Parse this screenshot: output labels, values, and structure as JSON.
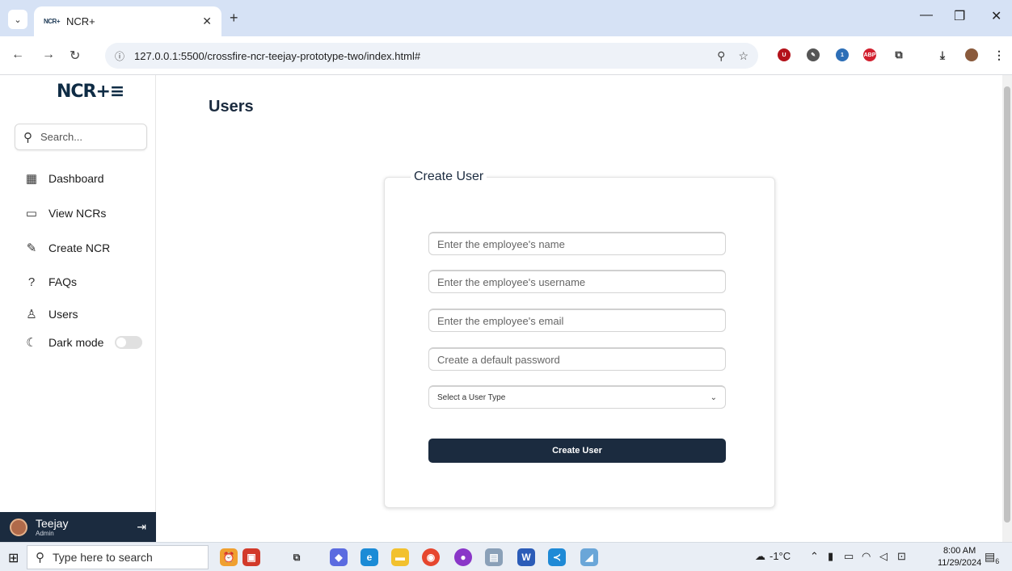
{
  "browser": {
    "tab_title": "NCR+",
    "tab_favicon": "NCR+",
    "url": "127.0.0.1:5500/crossfire-ncr-teejay-prototype-two/index.html#"
  },
  "sidebar": {
    "logo": "NCR+≡",
    "search_placeholder": "Search...",
    "items": [
      {
        "label": "Dashboard",
        "icon": "dashboard-icon"
      },
      {
        "label": "View NCRs",
        "icon": "folder-icon"
      },
      {
        "label": "Create NCR",
        "icon": "edit-icon"
      },
      {
        "label": "FAQs",
        "icon": "question-icon"
      },
      {
        "label": "Users",
        "icon": "user-icon"
      },
      {
        "label": "Dark mode",
        "icon": "moon-icon"
      }
    ],
    "dark_mode_on": false,
    "user": {
      "name": "Teejay",
      "role": "Admin"
    }
  },
  "main": {
    "title": "Users",
    "form": {
      "legend": "Create User",
      "name_placeholder": "Enter the employee's name",
      "username_placeholder": "Enter the employee's username",
      "email_placeholder": "Enter the employee's email",
      "password_placeholder": "Create a default password",
      "user_type_selected": "Select a User Type",
      "submit_label": "Create User"
    }
  },
  "taskbar": {
    "search_placeholder": "Type here to search",
    "weather": "-1°C",
    "time": "8:00 AM",
    "date": "11/29/2024",
    "notification_count": "6"
  },
  "colors": {
    "primary": "#1b2b3f",
    "tab_strip": "#d6e2f5"
  }
}
